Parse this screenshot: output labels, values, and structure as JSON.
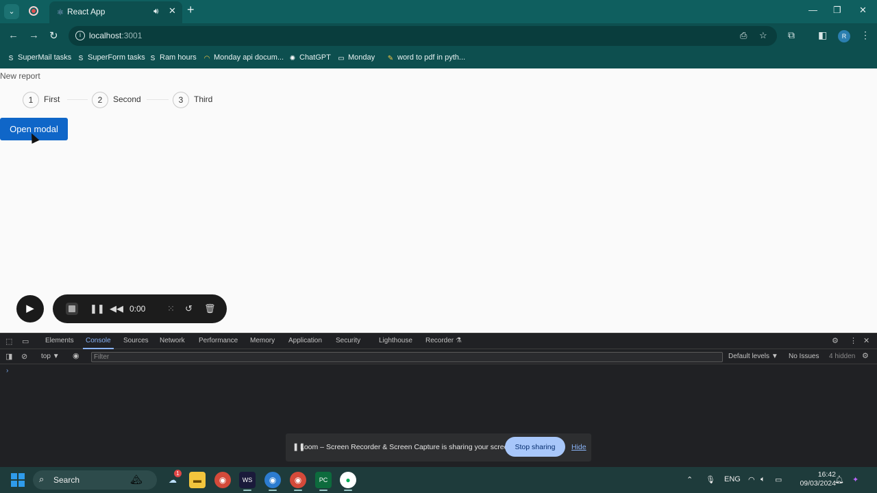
{
  "browser": {
    "tab_title": "React App",
    "url_host": "localhost",
    "url_port": ":3001",
    "bookmarks": [
      {
        "label": "SuperMail tasks",
        "icon": "superform-s-icon"
      },
      {
        "label": "SuperForm tasks",
        "icon": "superform-s-icon"
      },
      {
        "label": "Ram hours",
        "icon": "superform-s-icon"
      },
      {
        "label": "Monday api docum...",
        "icon": "monday-icon"
      },
      {
        "label": "ChatGPT",
        "icon": "chatgpt-icon"
      },
      {
        "label": "Monday",
        "icon": "folder-icon"
      },
      {
        "label": "word to pdf in pyth...",
        "icon": "bulb-icon"
      }
    ],
    "avatar_initial": "R"
  },
  "page": {
    "heading": "New report",
    "steps": [
      {
        "number": "1",
        "label": "First"
      },
      {
        "number": "2",
        "label": "Second"
      },
      {
        "number": "3",
        "label": "Third"
      }
    ],
    "open_modal_label": "Open modal"
  },
  "loom_controls": {
    "timer": "0:00"
  },
  "devtools": {
    "tabs": [
      "Elements",
      "Console",
      "Sources",
      "Network",
      "Performance",
      "Memory",
      "Application",
      "Security",
      "Lighthouse",
      "Recorder"
    ],
    "active_tab": "Console",
    "context": "top",
    "filter_placeholder": "Filter",
    "default_levels": "Default levels",
    "issues": "No Issues",
    "hidden": "4 hidden"
  },
  "sharing_bar": {
    "message": "Loom – Screen Recorder & Screen Capture is sharing your screen.",
    "stop_label": "Stop sharing",
    "hide_label": "Hide"
  },
  "taskbar": {
    "search_label": "Search",
    "notification_count": "1",
    "language": "ENG",
    "time": "16:42",
    "date": "09/03/2024"
  },
  "colors": {
    "browser_frame": "#0f5f5f",
    "primary_button": "#0f66c8",
    "devtools_bg": "#202124",
    "devtools_accent": "#8ab4f8",
    "stop_sharing_bg": "#a8c7fa"
  }
}
